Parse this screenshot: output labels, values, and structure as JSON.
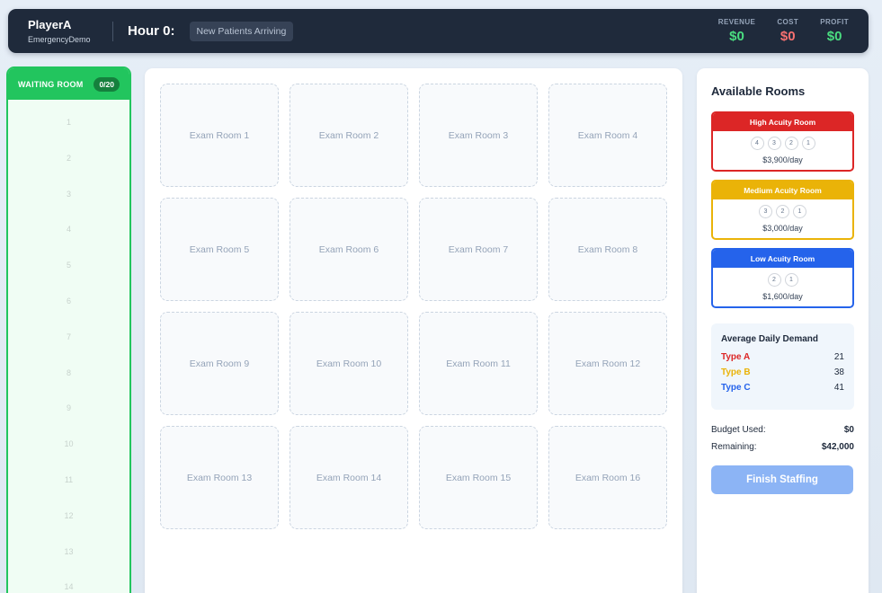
{
  "header": {
    "player_name": "PlayerA",
    "player_sub": "EmergencyDemo",
    "hour_label": "Hour 0:",
    "phase": "New Patients Arriving",
    "metrics": [
      {
        "label": "REVENUE",
        "value": "$0",
        "color": "#4ade80"
      },
      {
        "label": "COST",
        "value": "$0",
        "color": "#f87171"
      },
      {
        "label": "PROFIT",
        "value": "$0",
        "color": "#4ade80"
      }
    ]
  },
  "waiting_room": {
    "title": "WAITING ROOM",
    "count": "0/20",
    "slots": [
      "1",
      "2",
      "3",
      "4",
      "5",
      "6",
      "7",
      "8",
      "9",
      "10",
      "11",
      "12",
      "13",
      "14"
    ]
  },
  "exam_rooms": [
    "Exam Room 1",
    "Exam Room 2",
    "Exam Room 3",
    "Exam Room 4",
    "Exam Room 5",
    "Exam Room 6",
    "Exam Room 7",
    "Exam Room 8",
    "Exam Room 9",
    "Exam Room 10",
    "Exam Room 11",
    "Exam Room 12",
    "Exam Room 13",
    "Exam Room 14",
    "Exam Room 15",
    "Exam Room 16"
  ],
  "panel": {
    "title": "Available Rooms",
    "rooms": [
      {
        "name": "High Acuity Room",
        "color": "#dc2626",
        "levels": [
          "4",
          "3",
          "2",
          "1"
        ],
        "price": "$3,900/day"
      },
      {
        "name": "Medium Acuity Room",
        "color": "#eab308",
        "levels": [
          "3",
          "2",
          "1"
        ],
        "price": "$3,000/day"
      },
      {
        "name": "Low Acuity Room",
        "color": "#2563eb",
        "levels": [
          "2",
          "1"
        ],
        "price": "$1,600/day"
      }
    ],
    "demand": {
      "title": "Average Daily Demand",
      "rows": [
        {
          "type": "Type A",
          "value": "21"
        },
        {
          "type": "Type B",
          "value": "38"
        },
        {
          "type": "Type C",
          "value": "41"
        }
      ]
    },
    "budget_used_label": "Budget Used:",
    "budget_used": "$0",
    "remaining_label": "Remaining:",
    "remaining": "$42,000",
    "finish_label": "Finish Staffing"
  }
}
